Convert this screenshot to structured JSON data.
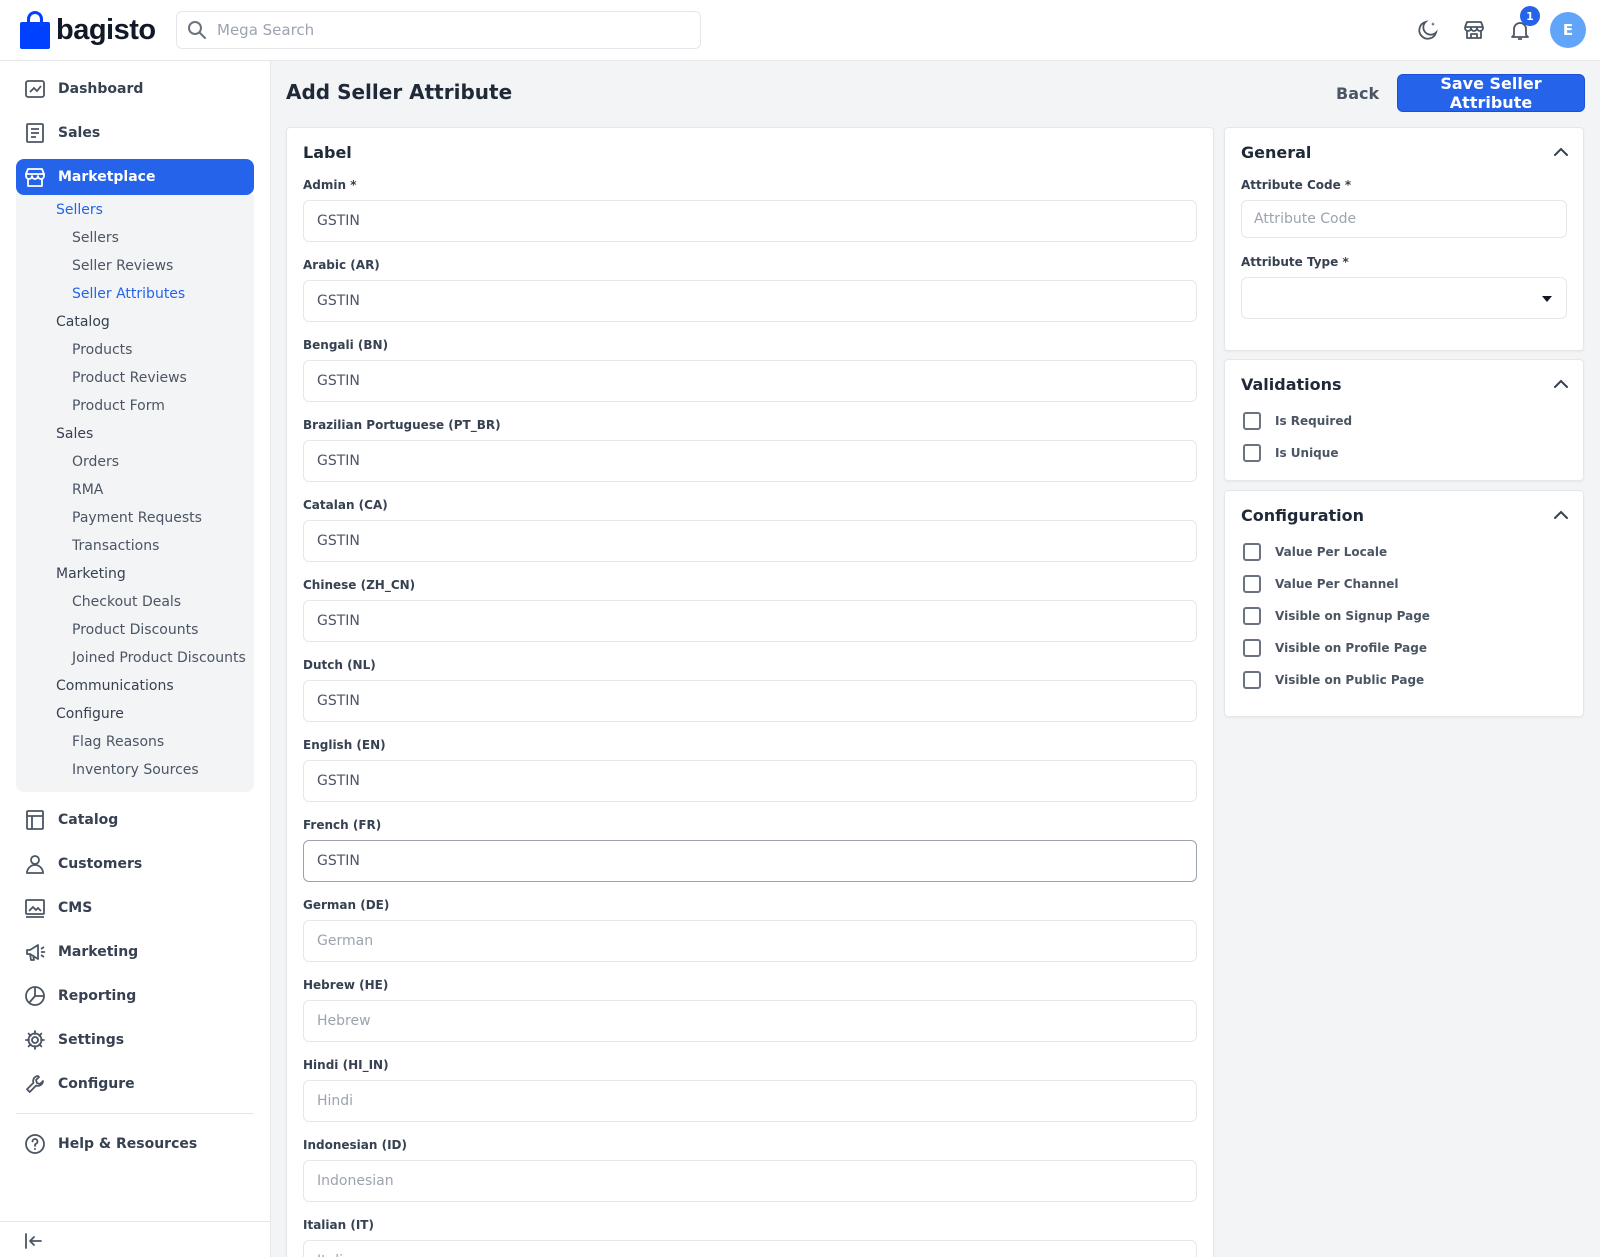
{
  "brand": {
    "name": "bagisto"
  },
  "search": {
    "placeholder": "Mega Search"
  },
  "header": {
    "notification_count": "1",
    "avatar_initial": "E"
  },
  "sidebar": {
    "items": [
      {
        "label": "Dashboard"
      },
      {
        "label": "Sales"
      },
      {
        "label": "Marketplace"
      },
      {
        "label": "Catalog"
      },
      {
        "label": "Customers"
      },
      {
        "label": "CMS"
      },
      {
        "label": "Marketing"
      },
      {
        "label": "Reporting"
      },
      {
        "label": "Settings"
      },
      {
        "label": "Configure"
      },
      {
        "label": "Help & Resources"
      }
    ],
    "marketplace_sub": [
      {
        "label": "Sellers",
        "level": 1
      },
      {
        "label": "Sellers",
        "level": 2
      },
      {
        "label": "Seller Reviews",
        "level": 2
      },
      {
        "label": "Seller Attributes",
        "level": 2
      },
      {
        "label": "Catalog",
        "level": 1
      },
      {
        "label": "Products",
        "level": 2
      },
      {
        "label": "Product Reviews",
        "level": 2
      },
      {
        "label": "Product Form",
        "level": 2
      },
      {
        "label": "Sales",
        "level": 1
      },
      {
        "label": "Orders",
        "level": 2
      },
      {
        "label": "RMA",
        "level": 2
      },
      {
        "label": "Payment Requests",
        "level": 2
      },
      {
        "label": "Transactions",
        "level": 2
      },
      {
        "label": "Marketing",
        "level": 1
      },
      {
        "label": "Checkout Deals",
        "level": 2
      },
      {
        "label": "Product Discounts",
        "level": 2
      },
      {
        "label": "Joined Product Discounts",
        "level": 2
      },
      {
        "label": "Communications",
        "level": 1
      },
      {
        "label": "Configure",
        "level": 1
      },
      {
        "label": "Flag Reasons",
        "level": 2
      },
      {
        "label": "Inventory Sources",
        "level": 2
      }
    ]
  },
  "page": {
    "title": "Add Seller Attribute",
    "back_label": "Back",
    "save_label": "Save Seller Attribute"
  },
  "label_card": {
    "title": "Label",
    "fields": [
      {
        "label": "Admin *",
        "value": "GSTIN",
        "placeholder": ""
      },
      {
        "label": "Arabic (AR)",
        "value": "GSTIN",
        "placeholder": ""
      },
      {
        "label": "Bengali (BN)",
        "value": "GSTIN",
        "placeholder": ""
      },
      {
        "label": "Brazilian Portuguese (PT_BR)",
        "value": "GSTIN",
        "placeholder": ""
      },
      {
        "label": "Catalan (CA)",
        "value": "GSTIN",
        "placeholder": ""
      },
      {
        "label": "Chinese (ZH_CN)",
        "value": "GSTIN",
        "placeholder": ""
      },
      {
        "label": "Dutch (NL)",
        "value": "GSTIN",
        "placeholder": ""
      },
      {
        "label": "English (EN)",
        "value": "GSTIN",
        "placeholder": ""
      },
      {
        "label": "French (FR)",
        "value": "GSTIN",
        "placeholder": ""
      },
      {
        "label": "German (DE)",
        "value": "",
        "placeholder": "German"
      },
      {
        "label": "Hebrew (HE)",
        "value": "",
        "placeholder": "Hebrew"
      },
      {
        "label": "Hindi (HI_IN)",
        "value": "",
        "placeholder": "Hindi"
      },
      {
        "label": "Indonesian (ID)",
        "value": "",
        "placeholder": "Indonesian"
      },
      {
        "label": "Italian (IT)",
        "value": "",
        "placeholder": "Italian"
      }
    ]
  },
  "general_card": {
    "title": "General",
    "code_label": "Attribute Code *",
    "code_placeholder": "Attribute Code",
    "type_label": "Attribute Type *",
    "type_value": ""
  },
  "validations_card": {
    "title": "Validations",
    "options": [
      "Is Required",
      "Is Unique"
    ]
  },
  "configuration_card": {
    "title": "Configuration",
    "options": [
      "Value Per Locale",
      "Value Per Channel",
      "Visible on Signup Page",
      "Visible on Profile Page",
      "Visible on Public Page"
    ]
  },
  "colors": {
    "accent": "#2563eb"
  }
}
